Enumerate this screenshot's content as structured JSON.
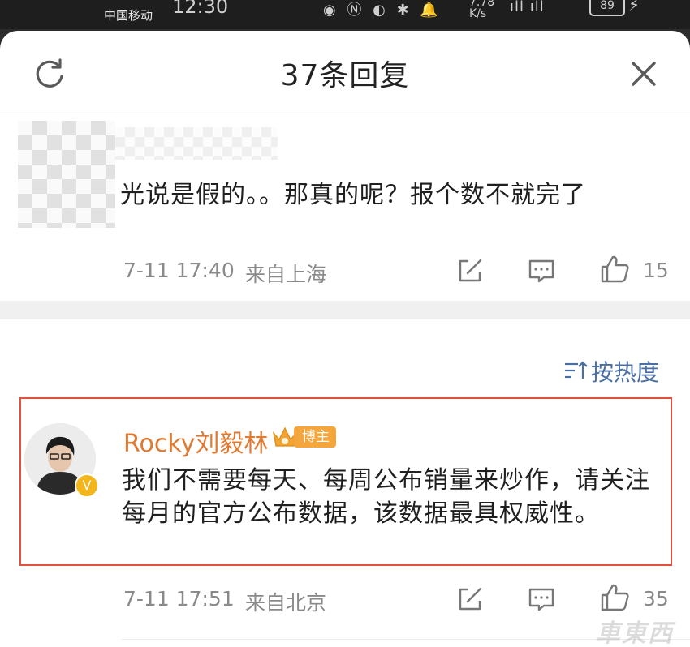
{
  "status_bar": {
    "carrier": "中国移动",
    "time": "12:30",
    "net_speed_top": "7.78",
    "net_speed_unit": "K/s",
    "battery": "89"
  },
  "header": {
    "title": "37条回复",
    "refresh_icon": "refresh-icon",
    "close_icon": "close-icon"
  },
  "original_comment": {
    "text": "光说是假的。。那真的呢？报个数不就完了",
    "date": "7-11 17:40",
    "location": "来自上海",
    "likes": "15"
  },
  "sort": {
    "label": "按热度",
    "icon": "sort-icon"
  },
  "reply": {
    "username": "Rocky刘毅林",
    "tag": "博主",
    "text": "我们不需要每天、每周公布销量来炒作，请关注每月的官方公布数据，该数据最具权威性。",
    "date": "7-11 17:51",
    "location": "来自北京",
    "likes": "35",
    "verified_badge": "V"
  },
  "watermark": "車東西",
  "colors": {
    "highlight_border": "#e0503a",
    "username": "#e07a32",
    "sort_text": "#4a6fa5",
    "meta_text": "#8a8a8a"
  }
}
